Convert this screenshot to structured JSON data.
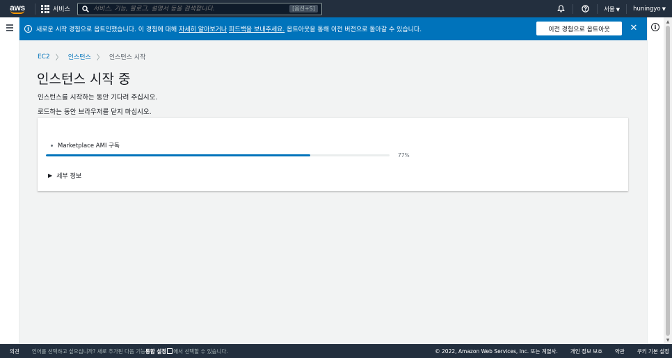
{
  "topnav": {
    "logo_text": "aws",
    "services_label": "서비스",
    "search_placeholder": "서비스, 기능, 블로그, 설명서 등을 검색합니다.",
    "search_shortcut": "[옵션+S]",
    "region_label": "서울",
    "user_label": "huningyo",
    "icons": [
      "grid-icon",
      "search-icon",
      "bell-icon",
      "help-icon",
      "caret-down-icon"
    ]
  },
  "banner": {
    "message_before": "새로운 시작 경험으로 옵트인했습니다. 이 경험에 대해 ",
    "link_learn": "자세히 알아보거나",
    "link_feedback": "피드백을 보내주세요.",
    "message_after": " 옵트아웃을 통해 이전 버전으로 돌아갈 수 있습니다.",
    "optout_button": "이전 경험으로 옵트아웃",
    "close_icon": "✕",
    "accent_color": "#0073bb"
  },
  "breadcrumb": {
    "items": [
      "EC2",
      "인스턴스",
      "인스턴스 시작"
    ],
    "separator": "〉"
  },
  "page": {
    "title": "인스턴스 시작 중",
    "description_1": "인스턴스를 시작하는 동안 기다려 주십시오.",
    "description_2": "로드하는 동안 브라우저를 닫지 마십시오."
  },
  "progress": {
    "step_label": "Marketplace AMI 구독",
    "percent": 77,
    "percent_label": "77%",
    "details_label": "세부 정보",
    "fill_color": "#0073bb"
  },
  "footer": {
    "feedback": "의견",
    "language_prefix": "언어를 선택하고 싶으십니까? 새로 추가된 다음 기능",
    "language_link": "통합 설정",
    "language_suffix": "에서 선택할 수 있습니다.",
    "copyright": "© 2022, Amazon Web Services, Inc. 또는 계열사.",
    "privacy": "개인 정보 보호",
    "terms": "약관",
    "cookies": "쿠키 기본 설정"
  }
}
